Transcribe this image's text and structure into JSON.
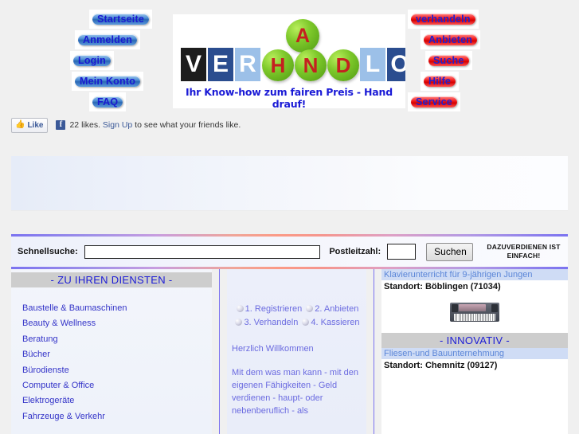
{
  "header": {
    "left_nav": [
      {
        "label": "Startseite"
      },
      {
        "label": "Anmelden"
      },
      {
        "label": "Login"
      },
      {
        "label": "Mein Konto"
      },
      {
        "label": "FAQ"
      }
    ],
    "right_nav": [
      {
        "label": "verhandeln"
      },
      {
        "label": "Anbieten"
      },
      {
        "label": "Suche"
      },
      {
        "label": "Hilfe"
      },
      {
        "label": "Service"
      }
    ],
    "logo": {
      "letters": [
        "V",
        "E",
        "R",
        "H",
        "A",
        "N",
        "D",
        "L",
        "O"
      ],
      "top_letter": "A",
      "tagline": "Ihr Know-how zum fairen Preis - Hand drauf!"
    }
  },
  "facebook": {
    "like_label": "Like",
    "f_glyph": "f",
    "text_before": "22 likes. ",
    "signup_link": "Sign Up",
    "text_after": " to see what your friends like."
  },
  "search": {
    "label_quick": "Schnellsuche:",
    "quick_value": "",
    "quick_placeholder": "",
    "label_zip": "Postleitzahl:",
    "zip_value": "",
    "zip_placeholder": "",
    "button_label": "Suchen",
    "slogan_line1": "DAZUVERDIENEN IST",
    "slogan_line2": "EINFACH!"
  },
  "left_column": {
    "heading": "- ZU IHREN DIENSTEN -",
    "categories": [
      "Baustelle & Baumaschinen",
      "Beauty & Wellness",
      "Beratung",
      "Bücher",
      "Bürodienste",
      "Computer & Office",
      "Elektrogeräte",
      "Fahrzeuge & Verkehr"
    ]
  },
  "middle_column": {
    "steps_line1_a": "1. Registrieren",
    "steps_line1_b": "2.",
    "steps_line2_a": "Anbieten",
    "steps_line2_b": "3. Verhandeln",
    "steps_line3": "4. Kassieren",
    "welcome_heading": "Herzlich Willkommen",
    "welcome_body": "Mit dem was man kann - mit den eigenen Fähigkeiten - Geld verdienen - haupt- oder nebenberuflich - als"
  },
  "right_column": {
    "ad1": {
      "title": "Klavierunterricht für 9-jährigen Jungen",
      "location": "Standort: Böblingen (71034)",
      "image_name": "keyboard-piano-photo"
    },
    "section_heading": "- INNOVATIV -",
    "ad2": {
      "title": "Fliesen-und Bauunternehmung",
      "location": "Standort: Chemnitz (09127)"
    }
  },
  "colors": {
    "blue_button": "#2a68b4",
    "red_button": "#f52020",
    "link_blue": "#3434c8",
    "heading_blue": "#1b1bd6",
    "divider_purple": "#7b73f0",
    "section_gray": "#cdcdcd",
    "ad_title_bg": "#cfdcf5"
  }
}
